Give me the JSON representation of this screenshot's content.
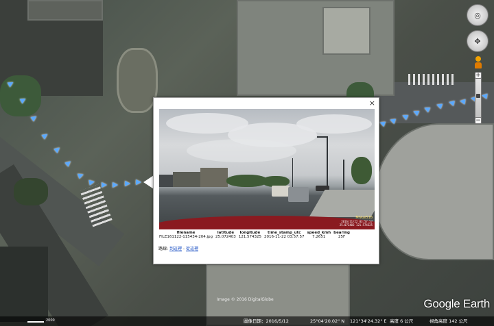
{
  "popup": {
    "close_label": "×",
    "photo_overlay": {
      "brand": "MiVue518",
      "stamp_line1": "2016/11/22 03:57:57",
      "stamp_line2": "25.072403 121.574325"
    },
    "table": {
      "headers": [
        "filename",
        "latitude",
        "longitude",
        "time_stamp_utc",
        "speed_kmh",
        "bearing"
      ],
      "rows": [
        [
          "FILE161122-115434-204.jpg",
          "25.072403",
          "121.574325",
          "2016-11-22 03:57:57",
          "7.2651",
          "25F"
        ]
      ]
    },
    "route": {
      "prefix": "路線:",
      "link1": "到這裡",
      "separator": " - ",
      "link2": "從這裡"
    }
  },
  "branding": {
    "logo": "Google Earth",
    "copyright": "Image © 2016 DigitalGlobe"
  },
  "statusbar": {
    "imagery_date": "圖像日期：2016/5/12",
    "lat": "25°04'20.02\" N",
    "lon": "121°34'24.32\" E",
    "elev": "高度 6 公尺",
    "eye_alt": "視角高度 142 公尺"
  },
  "scale": {
    "label": "2000"
  },
  "nav": {
    "look_glyph": "◎",
    "move_glyph": "✥",
    "zoom_in": "+",
    "zoom_out": "−"
  },
  "colors": {
    "track_arrow": "#5aa9ff",
    "link": "#1a4fc4",
    "pegman": "#f2a200"
  }
}
